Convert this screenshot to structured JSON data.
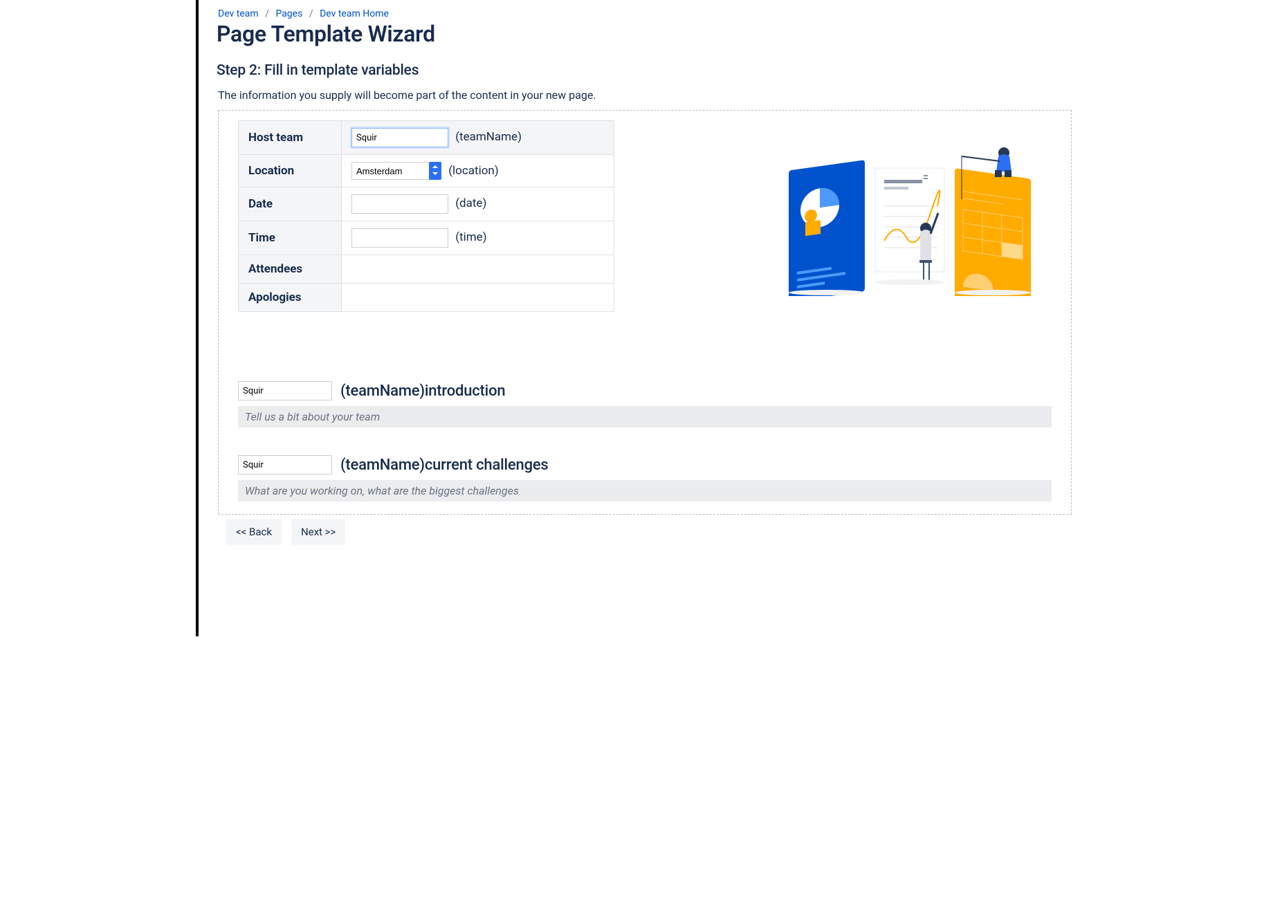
{
  "breadcrumbs": [
    {
      "label": "Dev team"
    },
    {
      "label": "Pages"
    },
    {
      "label": "Dev team Home"
    }
  ],
  "breadcrumb_sep": "/",
  "page_title": "Page Template Wizard",
  "step_heading": "Step 2: Fill in template variables",
  "step_description": "The information you supply will become part of the content in your new page.",
  "table": {
    "rows": [
      {
        "name": "Host team",
        "kind": "text",
        "value": "Squir",
        "var": "(teamName)",
        "focused": true
      },
      {
        "name": "Location",
        "kind": "select",
        "value": "Amsterdam",
        "var": "(location)"
      },
      {
        "name": "Date",
        "kind": "text",
        "value": "",
        "var": "(date)"
      },
      {
        "name": "Time",
        "kind": "text",
        "value": "",
        "var": "(time)"
      },
      {
        "name": "Attendees",
        "kind": "empty"
      },
      {
        "name": "Apologies",
        "kind": "empty"
      }
    ]
  },
  "sections": [
    {
      "input_value": "Squir",
      "heading": "(teamName)introduction",
      "hint": "Tell us a bit about your team"
    },
    {
      "input_value": "Squir",
      "heading": "(teamName)current challenges",
      "hint": "What are you working on, what are the biggest challenges"
    }
  ],
  "nav": {
    "back": "<< Back",
    "next": "Next >>"
  }
}
